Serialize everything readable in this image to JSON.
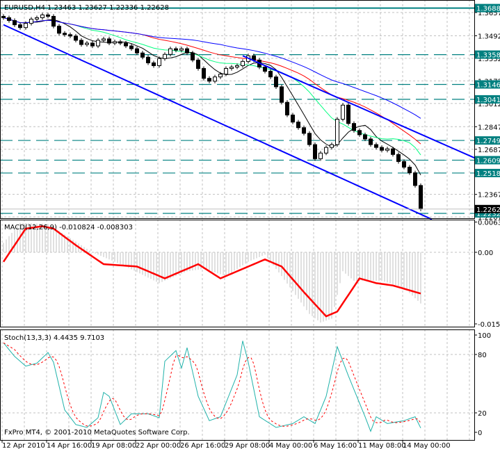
{
  "header": {
    "symbol": "EURUSD,H4",
    "ohlc": "1.23463 1.23627 1.22336 1.22628"
  },
  "macd_label": "MACD(12,26,9) -0.010824 -0.008303",
  "stoch_label": "Stoch(13,3,3) 4.4435 9.7103",
  "copyright": "FxPro MT4, © 2001-2010 MetaQuotes Software Corp.",
  "colors": {
    "level": "#008080",
    "channel": "#0000ff",
    "ma_fast": "#000000",
    "ma_green": "#00ff7f",
    "ma_red": "#ff0000",
    "ma_blue": "#0000ff",
    "macd_hist": "#c0c0c0",
    "macd_signal": "#ff0000",
    "stoch_main": "#20b2aa",
    "stoch_signal": "#ff0000"
  },
  "chart_data": [
    {
      "type": "candlestick",
      "title": "EURUSD,H4",
      "price_ticks": [
        "1.36570",
        "1.34920",
        "1.33320",
        "1.31720",
        "1.30120",
        "1.28470",
        "1.26870",
        "1.23670",
        "1.22070"
      ],
      "ylim": [
        1.2192,
        1.3745
      ],
      "levels": [
        "1.36885",
        "1.33583",
        "1.31469",
        "1.30412",
        "1.27495",
        "1.26096",
        "1.25184",
        "1.22322"
      ],
      "current_price": "1.22628",
      "close": [
        1.362,
        1.36,
        1.357,
        1.355,
        1.358,
        1.361,
        1.362,
        1.364,
        1.363,
        1.356,
        1.351,
        1.35,
        1.349,
        1.346,
        1.343,
        1.344,
        1.342,
        1.346,
        1.347,
        1.344,
        1.345,
        1.344,
        1.342,
        1.34,
        1.337,
        1.334,
        1.33,
        1.328,
        1.333,
        1.336,
        1.34,
        1.339,
        1.34,
        1.337,
        1.332,
        1.326,
        1.319,
        1.317,
        1.32,
        1.322,
        1.326,
        1.327,
        1.328,
        1.331,
        1.335,
        1.332,
        1.327,
        1.324,
        1.32,
        1.313,
        1.302,
        1.293,
        1.288,
        1.284,
        1.28,
        1.272,
        1.262,
        1.266,
        1.27,
        1.272,
        1.29,
        1.3,
        1.287,
        1.282,
        1.279,
        1.276,
        1.272,
        1.27,
        1.268,
        1.269,
        1.265,
        1.26,
        1.256,
        1.252,
        1.243,
        1.2263
      ],
      "moving_averages": [
        {
          "name": "fast",
          "period": 6
        },
        {
          "name": "green",
          "period": 14
        },
        {
          "name": "red",
          "period": 26
        },
        {
          "name": "blue",
          "period": 40
        }
      ],
      "channel_lines": [
        {
          "from": [
            0,
            1.357
          ],
          "to": [
            77,
            1.219
          ]
        },
        {
          "from": [
            43,
            1.335
          ],
          "to": [
            85,
            1.262
          ]
        }
      ]
    },
    {
      "type": "macd",
      "title": "MACD(12,26,9)",
      "ticks": [
        "0.00639",
        "0.00",
        "-0.0151"
      ],
      "ylim": [
        -0.0155,
        0.0068
      ],
      "main_keypoints": [
        [
          0,
          0.002
        ],
        [
          3,
          0.0062
        ],
        [
          8,
          0.006
        ],
        [
          12,
          0.003
        ],
        [
          16,
          0.0
        ],
        [
          22,
          -0.003
        ],
        [
          28,
          -0.0065
        ],
        [
          33,
          -0.004
        ],
        [
          36,
          -0.0035
        ],
        [
          40,
          -0.005
        ],
        [
          44,
          -0.002
        ],
        [
          47,
          -0.0005
        ],
        [
          50,
          -0.005
        ],
        [
          55,
          -0.013
        ],
        [
          57,
          -0.0148
        ],
        [
          59,
          -0.014
        ],
        [
          61,
          -0.004
        ],
        [
          63,
          -0.006
        ],
        [
          68,
          -0.006
        ],
        [
          72,
          -0.0075
        ],
        [
          75,
          -0.0108
        ]
      ],
      "signal_keypoints": [
        [
          0,
          -0.002
        ],
        [
          4,
          0.005
        ],
        [
          7,
          0.0055
        ],
        [
          9,
          0.005
        ],
        [
          13,
          0.0015
        ],
        [
          18,
          -0.0025
        ],
        [
          24,
          -0.003
        ],
        [
          29,
          -0.0055
        ],
        [
          32,
          -0.004
        ],
        [
          35,
          -0.0025
        ],
        [
          39,
          -0.0055
        ],
        [
          43,
          -0.0035
        ],
        [
          47,
          -0.0015
        ],
        [
          50,
          -0.003
        ],
        [
          54,
          -0.0084
        ],
        [
          58,
          -0.0135
        ],
        [
          60,
          -0.0125
        ],
        [
          64,
          -0.0055
        ],
        [
          67,
          -0.0065
        ],
        [
          70,
          -0.007
        ],
        [
          75,
          -0.0087
        ]
      ]
    },
    {
      "type": "stochastic",
      "title": "Stoch(13,3,3)",
      "ticks": [
        "100",
        "80",
        "20",
        "0"
      ],
      "ylim": [
        0,
        100
      ],
      "main_keypoints": [
        [
          0,
          92
        ],
        [
          2,
          78
        ],
        [
          4,
          68
        ],
        [
          6,
          71
        ],
        [
          8,
          82
        ],
        [
          9,
          72
        ],
        [
          11,
          23
        ],
        [
          13,
          8
        ],
        [
          15,
          5
        ],
        [
          17,
          15
        ],
        [
          18,
          41
        ],
        [
          19,
          37
        ],
        [
          21,
          8
        ],
        [
          23,
          19
        ],
        [
          26,
          19
        ],
        [
          28,
          15
        ],
        [
          29,
          73
        ],
        [
          31,
          84
        ],
        [
          32,
          66
        ],
        [
          33,
          87
        ],
        [
          35,
          37
        ],
        [
          37,
          12
        ],
        [
          39,
          16
        ],
        [
          42,
          59
        ],
        [
          43,
          94
        ],
        [
          44,
          72
        ],
        [
          46,
          16
        ],
        [
          49,
          5
        ],
        [
          52,
          9
        ],
        [
          54,
          16
        ],
        [
          56,
          9
        ],
        [
          58,
          37
        ],
        [
          60,
          88
        ],
        [
          62,
          58
        ],
        [
          65,
          16
        ],
        [
          66,
          1
        ],
        [
          67,
          16
        ],
        [
          69,
          9
        ],
        [
          72,
          12
        ],
        [
          74,
          16
        ],
        [
          75,
          4.4
        ]
      ],
      "signal_final": 9.7103
    }
  ],
  "time_labels": [
    "12 Apr 2010",
    "14 Apr 16:00",
    "19 Apr 08:00",
    "22 Apr 00:00",
    "26 Apr 16:00",
    "29 Apr 08:00",
    "4 May 00:00",
    "6 May 16:00",
    "11 May 08:00",
    "14 May 00:00"
  ]
}
